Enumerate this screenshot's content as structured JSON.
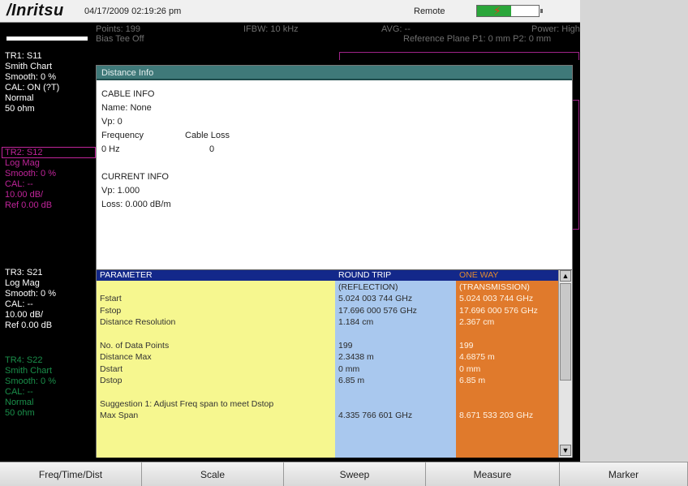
{
  "status_bar": {
    "brand": "/Inritsu",
    "datetime": "04/17/2009 02:19:26 pm",
    "remote": "Remote",
    "battery_level": 0.55,
    "battery_icon": "battery-charging-icon"
  },
  "screen_header": {
    "points": "Points: 199",
    "bias_tee": "Bias Tee Off",
    "ifbw": "IFBW: 10 kHz",
    "avg": "AVG: --",
    "power": "Power: High",
    "ref_plane": "Reference Plane P1: 0 mm P2: 0 mm"
  },
  "traces": [
    {
      "lines": [
        "TR1: S11",
        "Smith Chart",
        "Smooth: 0 %",
        "CAL: ON (?T)",
        "Normal",
        "50 ohm"
      ],
      "color": "#ffffff"
    },
    {
      "lines": [
        "TR2: S12",
        "Log Mag",
        "Smooth: 0 %",
        "CAL: --",
        "10.00 dB/",
        "Ref 0.00 dB"
      ],
      "color": "#c0249a"
    },
    {
      "lines": [
        "TR3: S21",
        "Log Mag",
        "Smooth: 0 %",
        "CAL: --",
        "10.00 dB/",
        "Ref 0.00 dB"
      ],
      "color": "#ffffff"
    },
    {
      "lines": [
        "TR4: S22",
        "Smith Chart",
        "Smooth: 0 %",
        "CAL: --",
        "Normal",
        "50 ohm"
      ],
      "color": "#1a8f4a"
    }
  ],
  "dialog": {
    "title": "Distance Info",
    "cable_info_heading": "CABLE INFO",
    "name": "Name: None",
    "vp": "Vp: 0",
    "freq_label": "Frequency",
    "cable_loss_label": "Cable Loss",
    "freq_value": "0 Hz",
    "cable_loss_value": "0",
    "current_info_heading": "CURRENT INFO",
    "current_vp": "Vp: 1.000",
    "current_loss": "Loss: 0.000 dB/m"
  },
  "table": {
    "headers": [
      "PARAMETER",
      "ROUND TRIP",
      "ONE WAY"
    ],
    "rows": [
      [
        "",
        "(REFLECTION)",
        "(TRANSMISSION)"
      ],
      [
        "Fstart",
        "5.024 003 744 GHz",
        "5.024 003 744 GHz"
      ],
      [
        "Fstop",
        "17.696 000 576 GHz",
        "17.696 000 576 GHz"
      ],
      [
        "Distance Resolution",
        "1.184 cm",
        "2.367 cm"
      ],
      [
        "",
        "",
        ""
      ],
      [
        "No. of Data Points",
        "199",
        "199"
      ],
      [
        "Distance Max",
        "2.3438 m",
        "4.6875 m"
      ],
      [
        "Dstart",
        "0 mm",
        "0 mm"
      ],
      [
        "Dstop",
        "6.85 m",
        "6.85 m"
      ],
      [
        "",
        "",
        ""
      ],
      [
        "Suggestion 1: Adjust Freq span to meet Dstop",
        "",
        ""
      ],
      [
        "Max Span",
        "4.335 766 601 GHz",
        "8.671 533 203 GHz"
      ]
    ]
  },
  "softkeys": [
    "Freq/Time/Dist",
    "Scale",
    "Sweep",
    "Measure",
    "Marker"
  ]
}
